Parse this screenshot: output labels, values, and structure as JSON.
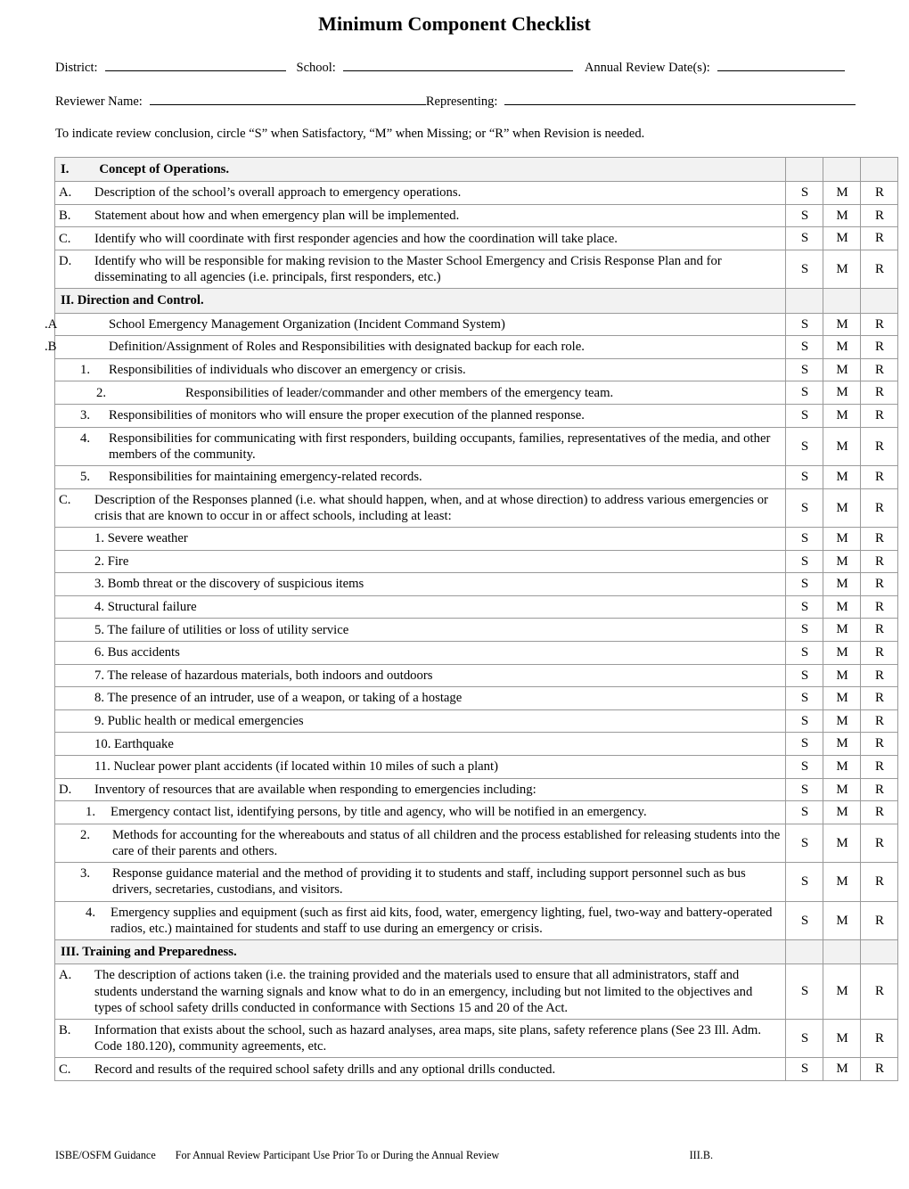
{
  "title": "Minimum Component Checklist",
  "header": {
    "district_label": "District:",
    "school_label": "School:",
    "review_date_label": "Annual Review Date(s):",
    "reviewer_label": "Reviewer Name:",
    "representing_label": "Representing:",
    "district_value": "",
    "school_value": "",
    "review_date_value": "",
    "reviewer_value": "",
    "representing_value": ""
  },
  "instruction": "To indicate review conclusion, circle “S” when Satisfactory, “M” when Missing; or “R” when Revision is needed.",
  "marks": {
    "s": "S",
    "m": "M",
    "r": "R"
  },
  "rows": [
    {
      "kind": "section",
      "num": "I.",
      "text": "Concept of Operations."
    },
    {
      "kind": "letter",
      "letter": "A.",
      "text": "Description of the school’s overall approach to emergency operations."
    },
    {
      "kind": "letter",
      "letter": "B.",
      "text": "Statement about how and when emergency plan will be implemented."
    },
    {
      "kind": "letter",
      "letter": "C.",
      "text": "Identify who will coordinate with first responder agencies and how the coordination will take place."
    },
    {
      "kind": "letter",
      "letter": "D.",
      "text": "Identify who will be responsible for making revision to the Master School Emergency and Crisis Response Plan and for disseminating to all agencies (i.e. principals, first responders, etc.)"
    },
    {
      "kind": "section",
      "num": "II.",
      "text": "Direction and Control."
    },
    {
      "kind": "dotletter",
      "letter": ".A",
      "text": "School Emergency Management Organization (Incident Command System)"
    },
    {
      "kind": "dotletter",
      "letter": ".B",
      "text": "Definition/Assignment of Roles and Responsibilities with designated backup for each role."
    },
    {
      "kind": "number",
      "num": "1.",
      "text": "Responsibilities of individuals who discover an emergency or crisis."
    },
    {
      "kind": "tabnumber",
      "num": "2.",
      "text": "Responsibilities of leader/commander and other members of the emergency team."
    },
    {
      "kind": "number",
      "num": "3.",
      "text": "Responsibilities of monitors who will ensure the proper execution of the planned response."
    },
    {
      "kind": "number",
      "num": "4.",
      "text": "Responsibilities for communicating with first responders, building occupants, families, representatives of the media, and other members of the community."
    },
    {
      "kind": "number",
      "num": "5.",
      "text": "Responsibilities for maintaining emergency-related records."
    },
    {
      "kind": "letter",
      "letter": "C.",
      "text": "Description of the Responses planned (i.e. what should happen, when, and at whose direction) to address various emergencies or crisis that are known to occur in or affect schools, including at least:"
    },
    {
      "kind": "plainnum",
      "text": "1. Severe weather"
    },
    {
      "kind": "plainnum",
      "text": "2. Fire"
    },
    {
      "kind": "plainnum",
      "text": "3. Bomb threat or the discovery of suspicious items"
    },
    {
      "kind": "plainnum",
      "text": "4. Structural failure"
    },
    {
      "kind": "plainnum",
      "text": "5. The failure of utilities or loss of utility service"
    },
    {
      "kind": "plainnum",
      "text": "6. Bus accidents"
    },
    {
      "kind": "plainnum",
      "text": "7. The release of hazardous materials, both indoors and outdoors"
    },
    {
      "kind": "plainnum",
      "text": "8. The presence of an intruder, use of a weapon, or taking of a hostage"
    },
    {
      "kind": "plainnum",
      "text": "9. Public health or medical emergencies"
    },
    {
      "kind": "plainnum",
      "text": "10.  Earthquake"
    },
    {
      "kind": "plainnum",
      "text": "11.  Nuclear power plant accidents (if located within 10 miles of such a plant)"
    },
    {
      "kind": "letter",
      "letter": "D.",
      "text": "Inventory of resources that are available when responding to emergencies including:"
    },
    {
      "kind": "tightnumber",
      "num": "1.",
      "text": "Emergency contact list, identifying persons, by title and agency, who will be notified in an emergency."
    },
    {
      "kind": "number2",
      "num": "2.",
      "text": "Methods for accounting for the whereabouts and status of all children and the process established for releasing students into the care of their parents and others."
    },
    {
      "kind": "number2",
      "num": "3.",
      "text": "Response guidance material and the method of providing it to students and staff, including support personnel such as bus drivers, secretaries, custodians, and visitors."
    },
    {
      "kind": "tightnumber",
      "num": "4.",
      "text": "Emergency supplies and equipment (such as first aid kits, food, water, emergency lighting, fuel, two-way and battery-operated radios, etc.) maintained for students and staff to use during an emergency or crisis."
    },
    {
      "kind": "section",
      "num": "III.",
      "text": "Training and Preparedness."
    },
    {
      "kind": "letter",
      "letter": "A.",
      "text": "The description of actions taken (i.e. the training provided and the materials used to ensure that all administrators, staff and students understand the warning signals and know what to do in an emergency, including but not limited to the objectives and types of school safety drills conducted in conformance with Sections 15 and 20 of the Act."
    },
    {
      "kind": "letter",
      "letter": "B.",
      "text": "Information that exists about the school, such as hazard analyses, area maps, site plans, safety reference plans (See 23 Ill. Adm. Code 180.120), community agreements, etc."
    },
    {
      "kind": "letter",
      "letter": "C.",
      "text": "Record and results of the required school safety drills and any optional drills conducted."
    }
  ],
  "footer": {
    "left": "ISBE/OSFM Guidance",
    "middle": "For Annual Review Participant Use Prior To or During the Annual Review",
    "right": "III.B."
  }
}
